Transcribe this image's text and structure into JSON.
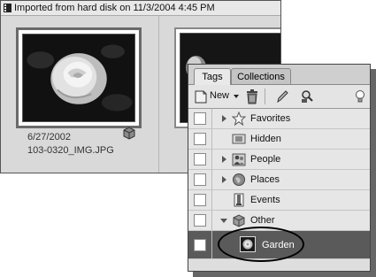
{
  "organizer": {
    "header_text": "Imported from hard disk on 11/3/2004 4:45 PM",
    "photo": {
      "date": "6/27/2002",
      "filename": "103-0320_IMG.JPG"
    }
  },
  "palette": {
    "tabs": [
      {
        "label": "Tags",
        "active": true
      },
      {
        "label": "Collections",
        "active": false
      }
    ],
    "toolbar": {
      "new_label": "New"
    },
    "tags": [
      {
        "label": "Favorites",
        "icon": "star-icon"
      },
      {
        "label": "Hidden",
        "icon": "hidden-icon"
      },
      {
        "label": "People",
        "icon": "people-icon"
      },
      {
        "label": "Places",
        "icon": "globe-icon"
      },
      {
        "label": "Events",
        "icon": "events-icon"
      },
      {
        "label": "Other",
        "icon": "other-icon"
      },
      {
        "label": "Garden",
        "icon": "garden-thumbnail-icon",
        "selected": true
      }
    ]
  },
  "colors": {
    "selected_row": "#5a5a5a",
    "panel": "#dedede"
  }
}
